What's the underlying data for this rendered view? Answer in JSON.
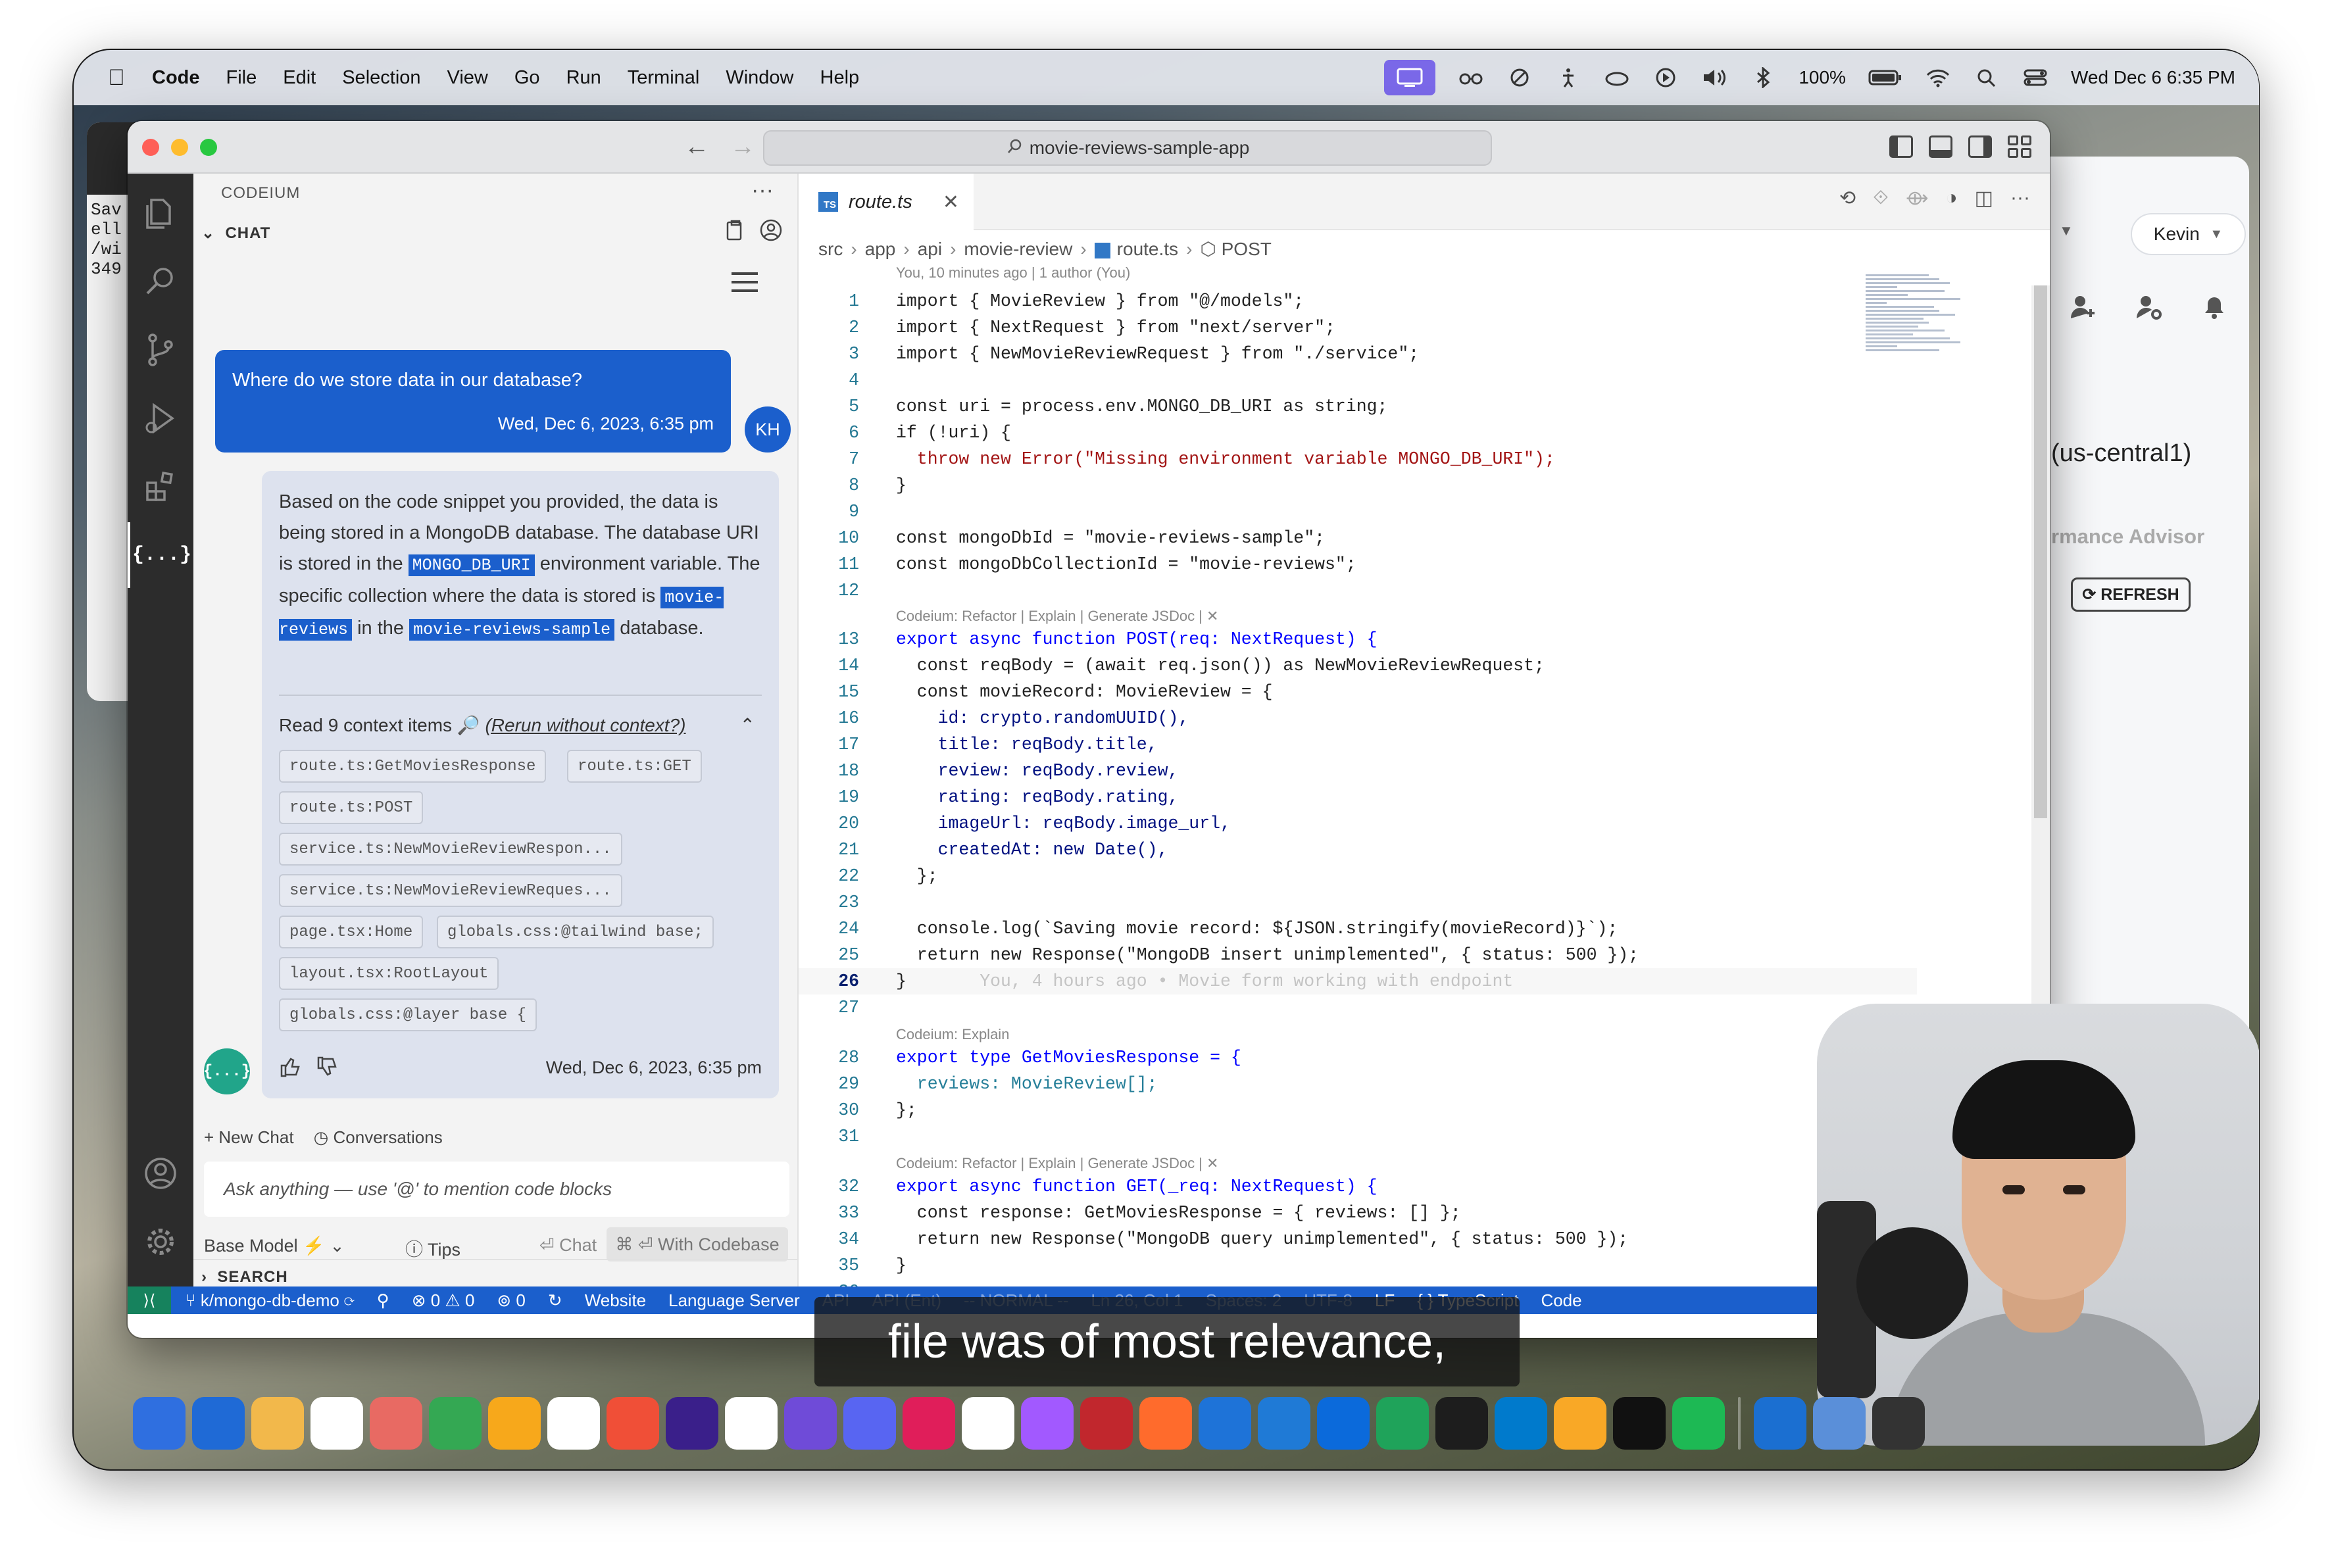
{
  "menubar": {
    "app": "Code",
    "items": [
      "File",
      "Edit",
      "Selection",
      "View",
      "Go",
      "Run",
      "Terminal",
      "Window",
      "Help"
    ],
    "battery": "100%",
    "datetime": "Wed Dec 6  6:35 PM"
  },
  "left_window": {
    "text": "Sav\nell\n/wi\n349"
  },
  "right_window": {
    "user": "Kevin",
    "region": "(us-central1)",
    "advisor": "rmance Advisor",
    "refresh": "REFRESH"
  },
  "window": {
    "search": "movie-reviews-sample-app"
  },
  "sidebar": {
    "header": "CODEIUM",
    "section": "CHAT",
    "user_message": {
      "text": "Where do we store data in our database?",
      "timestamp": "Wed, Dec 6, 2023, 6:35 pm",
      "initials": "KH"
    },
    "bot_message": {
      "p1": "Based on the code snippet you provided, the data is being stored in a MongoDB database. The database URI is stored in the ",
      "c1": "MONGO_DB_URI",
      "p2": " environment variable. The specific collection where the data is stored is ",
      "c2": "movie-reviews",
      "p3": " in the ",
      "c3": "movie-reviews-sample",
      "p4": " database.",
      "context_label": "Read 9 context items 🔎",
      "rerun": "(Rerun without context?)",
      "chips": [
        "route.ts:GetMoviesResponse",
        "route.ts:GET",
        "route.ts:POST",
        "service.ts:NewMovieReviewRespon...",
        "service.ts:NewMovieReviewReques...",
        "page.tsx:Home",
        "globals.css:@tailwind base;",
        "layout.tsx:RootLayout",
        "globals.css:@layer base {"
      ],
      "timestamp": "Wed, Dec 6, 2023, 6:35 pm",
      "avatar": "{...}"
    },
    "new_chat": "+ New Chat",
    "conversations": "Conversations",
    "input_placeholder": "Ask anything — use '@' to mention code blocks",
    "base_model": "Base Model ⚡",
    "tips": "Tips",
    "chat": "Chat",
    "with_codebase": "⌘ ⏎ With Codebase",
    "search_section": "SEARCH"
  },
  "editor": {
    "tab": "route.ts",
    "breadcrumb": [
      "src",
      "app",
      "api",
      "movie-review",
      "route.ts",
      "POST"
    ],
    "blame": "You, 10 minutes ago | 1 author (You)",
    "lens_refactor": "Codeium: Refactor | Explain | Generate JSDoc | ✕",
    "lens_explain": "Codeium: Explain",
    "ghost_blame": "You, 4 hours ago • Movie form working with endpoint",
    "line_numbers": [
      "1",
      "2",
      "3",
      "4",
      "5",
      "6",
      "7",
      "8",
      "9",
      "10",
      "11",
      "12",
      "13",
      "14",
      "15",
      "16",
      "17",
      "18",
      "19",
      "20",
      "21",
      "22",
      "23",
      "24",
      "25",
      "26",
      "27",
      "28",
      "29",
      "30",
      "31",
      "32",
      "33",
      "34",
      "35",
      "36"
    ],
    "code": {
      "l1": "import { MovieReview } from \"@/models\";",
      "l2": "import { NextRequest } from \"next/server\";",
      "l3": "import { NewMovieReviewRequest } from \"./service\";",
      "l5": "const uri = process.env.MONGO_DB_URI as string;",
      "l6": "if (!uri) {",
      "l7": "  throw new Error(\"Missing environment variable MONGO_DB_URI\");",
      "l8": "}",
      "l10": "const mongoDbId = \"movie-reviews-sample\";",
      "l11": "const mongoDbCollectionId = \"movie-reviews\";",
      "l13": "export async function POST(req: NextRequest) {",
      "l14": "  const reqBody = (await req.json()) as NewMovieReviewRequest;",
      "l15": "  const movieRecord: MovieReview = {",
      "l16": "    id: crypto.randomUUID(),",
      "l17": "    title: reqBody.title,",
      "l18": "    review: reqBody.review,",
      "l19": "    rating: reqBody.rating,",
      "l20": "    imageUrl: reqBody.image_url,",
      "l21": "    createdAt: new Date(),",
      "l22": "  };",
      "l24": "  console.log(`Saving movie record: ${JSON.stringify(movieRecord)}`);",
      "l25": "  return new Response(\"MongoDB insert unimplemented\", { status: 500 });",
      "l26": "}",
      "l28": "export type GetMoviesResponse = {",
      "l29": "  reviews: MovieReview[];",
      "l30": "};",
      "l32": "export async function GET(_req: NextRequest) {",
      "l33": "  const response: GetMoviesResponse = { reviews: [] };",
      "l34": "  return new Response(\"MongoDB query unimplemented\", { status: 500 });",
      "l35": "}"
    }
  },
  "statusbar": {
    "branch": "k/mongo-db-demo",
    "problems": "⊗ 0 ⚠ 0",
    "ports": "0",
    "website": "Website",
    "language_server": "Language Server",
    "api": "API",
    "api_ent": "API (Ent)",
    "vim_mode": "-- NORMAL --",
    "position": "Ln 26, Col 1",
    "spaces": "Spaces: 2",
    "encoding": "UTF-8",
    "eol": "LF",
    "language": "{ } TypeScript",
    "codeium": "Code"
  },
  "caption": "file was of most relevance,",
  "dock_colors": [
    "#2f6fe0",
    "#1f6ad6",
    "#f2b84b",
    "#ffffff",
    "#e86a63",
    "#34a853",
    "#f7a81b",
    "#ffffff",
    "#f04f37",
    "#3a1f8a",
    "#ffffff",
    "#6f4bd8",
    "#5865f2",
    "#e01e5a",
    "#ffffff",
    "#a259ff",
    "#c1272d",
    "#ff6b2c",
    "#1e73d8",
    "#1f7ad6",
    "#0b6adb",
    "#1fa35a",
    "#1d1d1d",
    "#007acc",
    "#f9a826",
    "#111111",
    "#1db954",
    "#1b6fd1",
    "#5a8fd9",
    "#333333"
  ]
}
